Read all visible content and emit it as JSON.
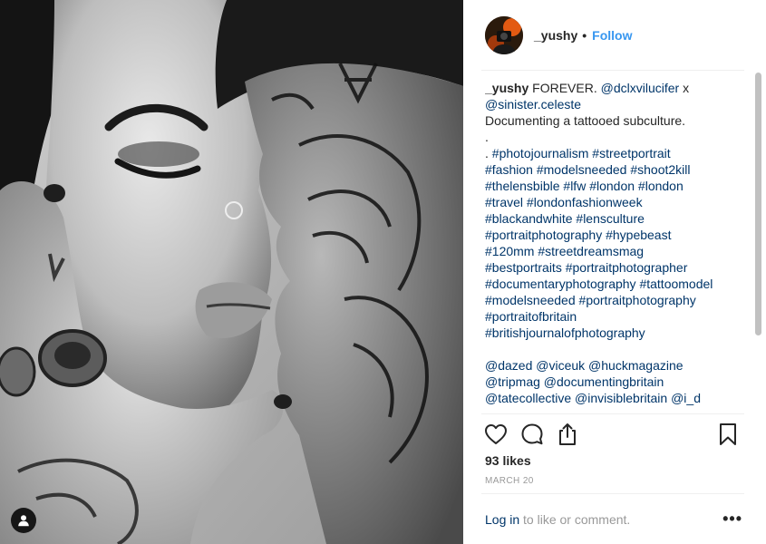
{
  "author": {
    "username": "_yushy",
    "separator": "•",
    "follow_label": "Follow",
    "avatar_icon": "profile-photo-icon"
  },
  "caption": {
    "lines": [
      [
        {
          "t": "u",
          "v": "_yushy"
        },
        {
          "t": "text",
          "v": " FOREVER. "
        },
        {
          "t": "mention",
          "v": "@dclxvilucifer"
        },
        {
          "t": "text",
          "v": " x"
        }
      ],
      [
        {
          "t": "mention",
          "v": "@sinister.celeste"
        }
      ],
      [
        {
          "t": "text",
          "v": "Documenting a tattooed subculture."
        }
      ],
      [
        {
          "t": "text",
          "v": "."
        }
      ],
      [
        {
          "t": "text",
          "v": ". "
        },
        {
          "t": "hash",
          "v": "#photojournalism"
        },
        {
          "t": "text",
          "v": " "
        },
        {
          "t": "hash",
          "v": "#streetportrait"
        }
      ],
      [
        {
          "t": "hash",
          "v": "#fashion"
        },
        {
          "t": "text",
          "v": " "
        },
        {
          "t": "hash",
          "v": "#modelsneeded"
        },
        {
          "t": "text",
          "v": " "
        },
        {
          "t": "hash",
          "v": "#shoot2kill"
        }
      ],
      [
        {
          "t": "hash",
          "v": "#thelensbible"
        },
        {
          "t": "text",
          "v": " "
        },
        {
          "t": "hash",
          "v": "#lfw"
        },
        {
          "t": "text",
          "v": " "
        },
        {
          "t": "hash",
          "v": "#london"
        },
        {
          "t": "text",
          "v": " "
        },
        {
          "t": "hash",
          "v": "#london"
        }
      ],
      [
        {
          "t": "hash",
          "v": "#travel"
        },
        {
          "t": "text",
          "v": " "
        },
        {
          "t": "hash",
          "v": "#londonfashionweek"
        }
      ],
      [
        {
          "t": "hash",
          "v": "#blackandwhite"
        },
        {
          "t": "text",
          "v": " "
        },
        {
          "t": "hash",
          "v": "#lensculture"
        }
      ],
      [
        {
          "t": "hash",
          "v": "#portraitphotography"
        },
        {
          "t": "text",
          "v": " "
        },
        {
          "t": "hash",
          "v": "#hypebeast"
        }
      ],
      [
        {
          "t": "hash",
          "v": "#120mm"
        },
        {
          "t": "text",
          "v": " "
        },
        {
          "t": "hash",
          "v": "#streetdreamsmag"
        }
      ],
      [
        {
          "t": "hash",
          "v": "#bestportraits"
        },
        {
          "t": "text",
          "v": " "
        },
        {
          "t": "hash",
          "v": "#portraitphotographer"
        }
      ],
      [
        {
          "t": "hash",
          "v": "#documentaryphotography"
        },
        {
          "t": "text",
          "v": " "
        },
        {
          "t": "hash",
          "v": "#tattoomodel"
        }
      ],
      [
        {
          "t": "hash",
          "v": "#modelsneeded"
        },
        {
          "t": "text",
          "v": " "
        },
        {
          "t": "hash",
          "v": "#portraitphotography"
        }
      ],
      [
        {
          "t": "hash",
          "v": "#portraitofbritain"
        }
      ],
      [
        {
          "t": "hash",
          "v": "#britishjournalofphotography"
        }
      ],
      [],
      [
        {
          "t": "mention",
          "v": "@dazed"
        },
        {
          "t": "text",
          "v": " "
        },
        {
          "t": "mention",
          "v": "@viceuk"
        },
        {
          "t": "text",
          "v": " "
        },
        {
          "t": "mention",
          "v": "@huckmagazine"
        }
      ],
      [
        {
          "t": "mention",
          "v": "@tripmag"
        },
        {
          "t": "text",
          "v": " "
        },
        {
          "t": "mention",
          "v": "@documentingbritain"
        }
      ],
      [
        {
          "t": "mention",
          "v": "@tatecollective"
        },
        {
          "t": "text",
          "v": " "
        },
        {
          "t": "mention",
          "v": "@invisiblebritain"
        },
        {
          "t": "text",
          "v": " "
        },
        {
          "t": "mention",
          "v": "@i_d"
        }
      ]
    ]
  },
  "actions": {
    "like_icon": "heart-icon",
    "comment_icon": "comment-icon",
    "share_icon": "share-icon",
    "save_icon": "bookmark-icon"
  },
  "likes_text": "93 likes",
  "date_text": "MARCH 20",
  "comment_prompt": {
    "login_label": "Log in",
    "rest": " to like or comment."
  },
  "more_label": "•••",
  "photo": {
    "tag_icon": "person-tag-icon"
  },
  "colors": {
    "link": "#003569",
    "follow": "#3897f0",
    "text": "#262626",
    "muted": "#999999",
    "divider": "#efefef"
  }
}
